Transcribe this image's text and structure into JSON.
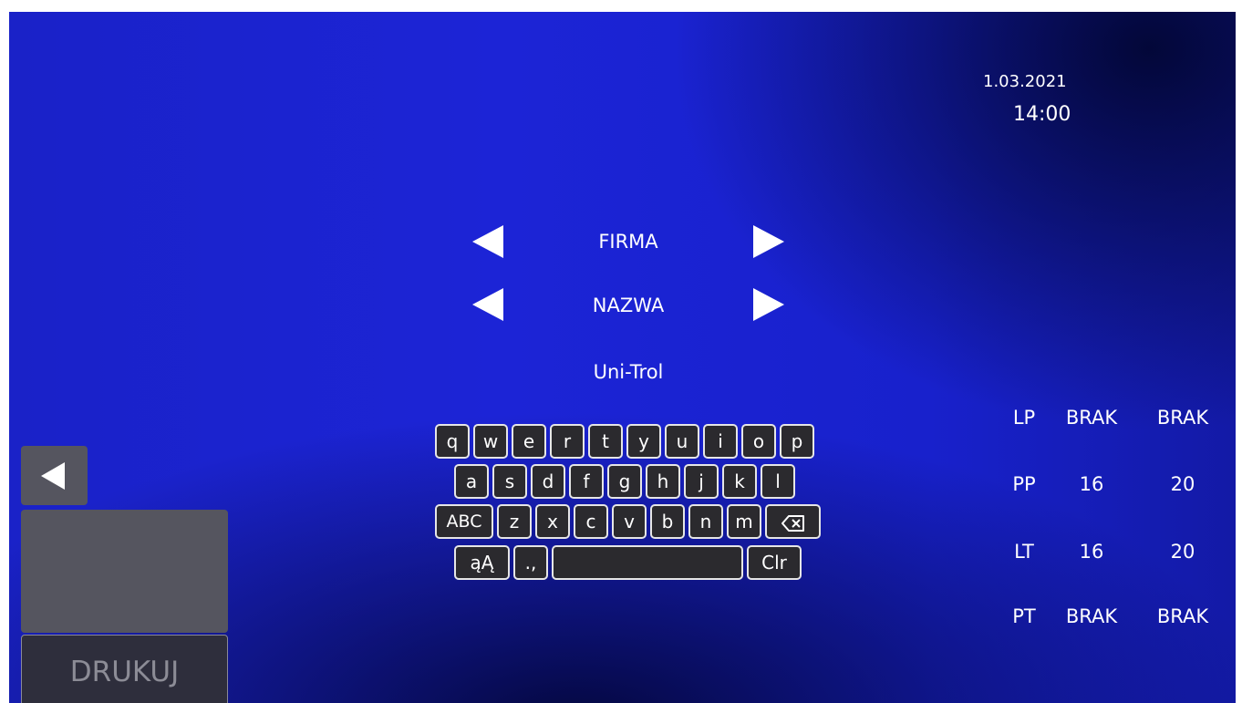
{
  "header": {
    "date": "1.03.2021",
    "time": "14:00"
  },
  "selectors": {
    "field": "FIRMA",
    "name": "NAZWA",
    "value": "Uni-Trol"
  },
  "keyboard": {
    "row1": [
      "q",
      "w",
      "e",
      "r",
      "t",
      "y",
      "u",
      "i",
      "o",
      "p"
    ],
    "row2": [
      "a",
      "s",
      "d",
      "f",
      "g",
      "h",
      "j",
      "k",
      "l"
    ],
    "row3_shift": "ABC",
    "row3": [
      "z",
      "x",
      "c",
      "v",
      "b",
      "n",
      "m"
    ],
    "backspace_icon": "backspace-icon",
    "row4_alt": "ąĄ",
    "row4_punct": ".,",
    "space": "",
    "clear": "Clr"
  },
  "status_table": {
    "rows": [
      {
        "label": "LP",
        "col1": "BRAK",
        "col2": "BRAK"
      },
      {
        "label": "PP",
        "col1": "16",
        "col2": "20"
      },
      {
        "label": "LT",
        "col1": "16",
        "col2": "20"
      },
      {
        "label": "PT",
        "col1": "BRAK",
        "col2": "BRAK"
      }
    ]
  },
  "left_panel": {
    "print_label": "DRUKUJ",
    "back_icon": "arrow-left-icon"
  },
  "colors": {
    "background": "#1c24d6",
    "key_bg": "#2b2a2e",
    "panel_gray": "#55555f"
  }
}
